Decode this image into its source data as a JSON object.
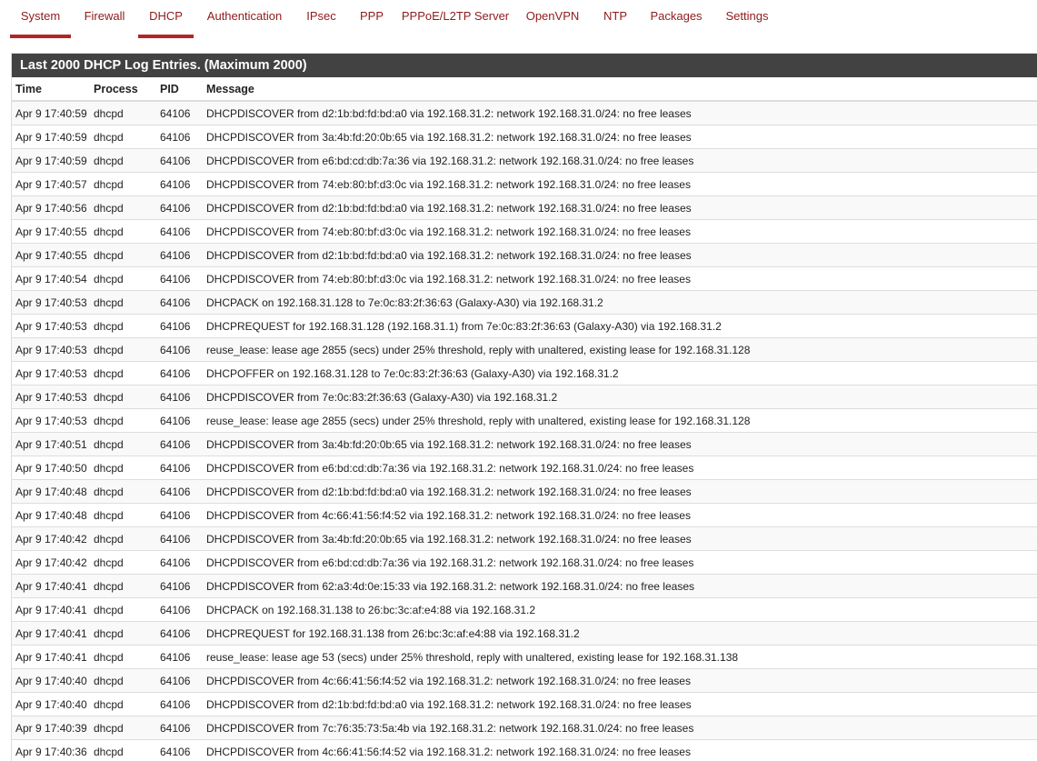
{
  "nav": {
    "tabs": [
      {
        "label": "System",
        "active": true
      },
      {
        "label": "Firewall",
        "active": false
      },
      {
        "label": "DHCP",
        "active": true
      },
      {
        "label": "Authentication",
        "active": false
      },
      {
        "label": "IPsec",
        "active": false
      },
      {
        "label": "PPP",
        "active": false
      },
      {
        "label": "PPPoE/L2TP Server",
        "active": false
      },
      {
        "label": "OpenVPN",
        "active": false
      },
      {
        "label": "NTP",
        "active": false
      },
      {
        "label": "Packages",
        "active": false
      },
      {
        "label": "Settings",
        "active": false
      }
    ],
    "accent_color": "#b32525",
    "text_color": "#8f1b1b"
  },
  "panel": {
    "title": "Last 2000 DHCP Log Entries. (Maximum 2000)",
    "header_bg": "#424242"
  },
  "table": {
    "columns": [
      "Time",
      "Process",
      "PID",
      "Message"
    ],
    "rows": [
      [
        "Apr 9 17:40:59",
        "dhcpd",
        "64106",
        "DHCPDISCOVER from d2:1b:bd:fd:bd:a0 via 192.168.31.2: network 192.168.31.0/24: no free leases"
      ],
      [
        "Apr 9 17:40:59",
        "dhcpd",
        "64106",
        "DHCPDISCOVER from 3a:4b:fd:20:0b:65 via 192.168.31.2: network 192.168.31.0/24: no free leases"
      ],
      [
        "Apr 9 17:40:59",
        "dhcpd",
        "64106",
        "DHCPDISCOVER from e6:bd:cd:db:7a:36 via 192.168.31.2: network 192.168.31.0/24: no free leases"
      ],
      [
        "Apr 9 17:40:57",
        "dhcpd",
        "64106",
        "DHCPDISCOVER from 74:eb:80:bf:d3:0c via 192.168.31.2: network 192.168.31.0/24: no free leases"
      ],
      [
        "Apr 9 17:40:56",
        "dhcpd",
        "64106",
        "DHCPDISCOVER from d2:1b:bd:fd:bd:a0 via 192.168.31.2: network 192.168.31.0/24: no free leases"
      ],
      [
        "Apr 9 17:40:55",
        "dhcpd",
        "64106",
        "DHCPDISCOVER from 74:eb:80:bf:d3:0c via 192.168.31.2: network 192.168.31.0/24: no free leases"
      ],
      [
        "Apr 9 17:40:55",
        "dhcpd",
        "64106",
        "DHCPDISCOVER from d2:1b:bd:fd:bd:a0 via 192.168.31.2: network 192.168.31.0/24: no free leases"
      ],
      [
        "Apr 9 17:40:54",
        "dhcpd",
        "64106",
        "DHCPDISCOVER from 74:eb:80:bf:d3:0c via 192.168.31.2: network 192.168.31.0/24: no free leases"
      ],
      [
        "Apr 9 17:40:53",
        "dhcpd",
        "64106",
        "DHCPACK on 192.168.31.128 to 7e:0c:83:2f:36:63 (Galaxy-A30) via 192.168.31.2"
      ],
      [
        "Apr 9 17:40:53",
        "dhcpd",
        "64106",
        "DHCPREQUEST for 192.168.31.128 (192.168.31.1) from 7e:0c:83:2f:36:63 (Galaxy-A30) via 192.168.31.2"
      ],
      [
        "Apr 9 17:40:53",
        "dhcpd",
        "64106",
        "reuse_lease: lease age 2855 (secs) under 25% threshold, reply with unaltered, existing lease for 192.168.31.128"
      ],
      [
        "Apr 9 17:40:53",
        "dhcpd",
        "64106",
        "DHCPOFFER on 192.168.31.128 to 7e:0c:83:2f:36:63 (Galaxy-A30) via 192.168.31.2"
      ],
      [
        "Apr 9 17:40:53",
        "dhcpd",
        "64106",
        "DHCPDISCOVER from 7e:0c:83:2f:36:63 (Galaxy-A30) via 192.168.31.2"
      ],
      [
        "Apr 9 17:40:53",
        "dhcpd",
        "64106",
        "reuse_lease: lease age 2855 (secs) under 25% threshold, reply with unaltered, existing lease for 192.168.31.128"
      ],
      [
        "Apr 9 17:40:51",
        "dhcpd",
        "64106",
        "DHCPDISCOVER from 3a:4b:fd:20:0b:65 via 192.168.31.2: network 192.168.31.0/24: no free leases"
      ],
      [
        "Apr 9 17:40:50",
        "dhcpd",
        "64106",
        "DHCPDISCOVER from e6:bd:cd:db:7a:36 via 192.168.31.2: network 192.168.31.0/24: no free leases"
      ],
      [
        "Apr 9 17:40:48",
        "dhcpd",
        "64106",
        "DHCPDISCOVER from d2:1b:bd:fd:bd:a0 via 192.168.31.2: network 192.168.31.0/24: no free leases"
      ],
      [
        "Apr 9 17:40:48",
        "dhcpd",
        "64106",
        "DHCPDISCOVER from 4c:66:41:56:f4:52 via 192.168.31.2: network 192.168.31.0/24: no free leases"
      ],
      [
        "Apr 9 17:40:42",
        "dhcpd",
        "64106",
        "DHCPDISCOVER from 3a:4b:fd:20:0b:65 via 192.168.31.2: network 192.168.31.0/24: no free leases"
      ],
      [
        "Apr 9 17:40:42",
        "dhcpd",
        "64106",
        "DHCPDISCOVER from e6:bd:cd:db:7a:36 via 192.168.31.2: network 192.168.31.0/24: no free leases"
      ],
      [
        "Apr 9 17:40:41",
        "dhcpd",
        "64106",
        "DHCPDISCOVER from 62:a3:4d:0e:15:33 via 192.168.31.2: network 192.168.31.0/24: no free leases"
      ],
      [
        "Apr 9 17:40:41",
        "dhcpd",
        "64106",
        "DHCPACK on 192.168.31.138 to 26:bc:3c:af:e4:88 via 192.168.31.2"
      ],
      [
        "Apr 9 17:40:41",
        "dhcpd",
        "64106",
        "DHCPREQUEST for 192.168.31.138 from 26:bc:3c:af:e4:88 via 192.168.31.2"
      ],
      [
        "Apr 9 17:40:41",
        "dhcpd",
        "64106",
        "reuse_lease: lease age 53 (secs) under 25% threshold, reply with unaltered, existing lease for 192.168.31.138"
      ],
      [
        "Apr 9 17:40:40",
        "dhcpd",
        "64106",
        "DHCPDISCOVER from 4c:66:41:56:f4:52 via 192.168.31.2: network 192.168.31.0/24: no free leases"
      ],
      [
        "Apr 9 17:40:40",
        "dhcpd",
        "64106",
        "DHCPDISCOVER from d2:1b:bd:fd:bd:a0 via 192.168.31.2: network 192.168.31.0/24: no free leases"
      ],
      [
        "Apr 9 17:40:39",
        "dhcpd",
        "64106",
        "DHCPDISCOVER from 7c:76:35:73:5a:4b via 192.168.31.2: network 192.168.31.0/24: no free leases"
      ],
      [
        "Apr 9 17:40:36",
        "dhcpd",
        "64106",
        "DHCPDISCOVER from 4c:66:41:56:f4:52 via 192.168.31.2: network 192.168.31.0/24: no free leases"
      ]
    ]
  }
}
